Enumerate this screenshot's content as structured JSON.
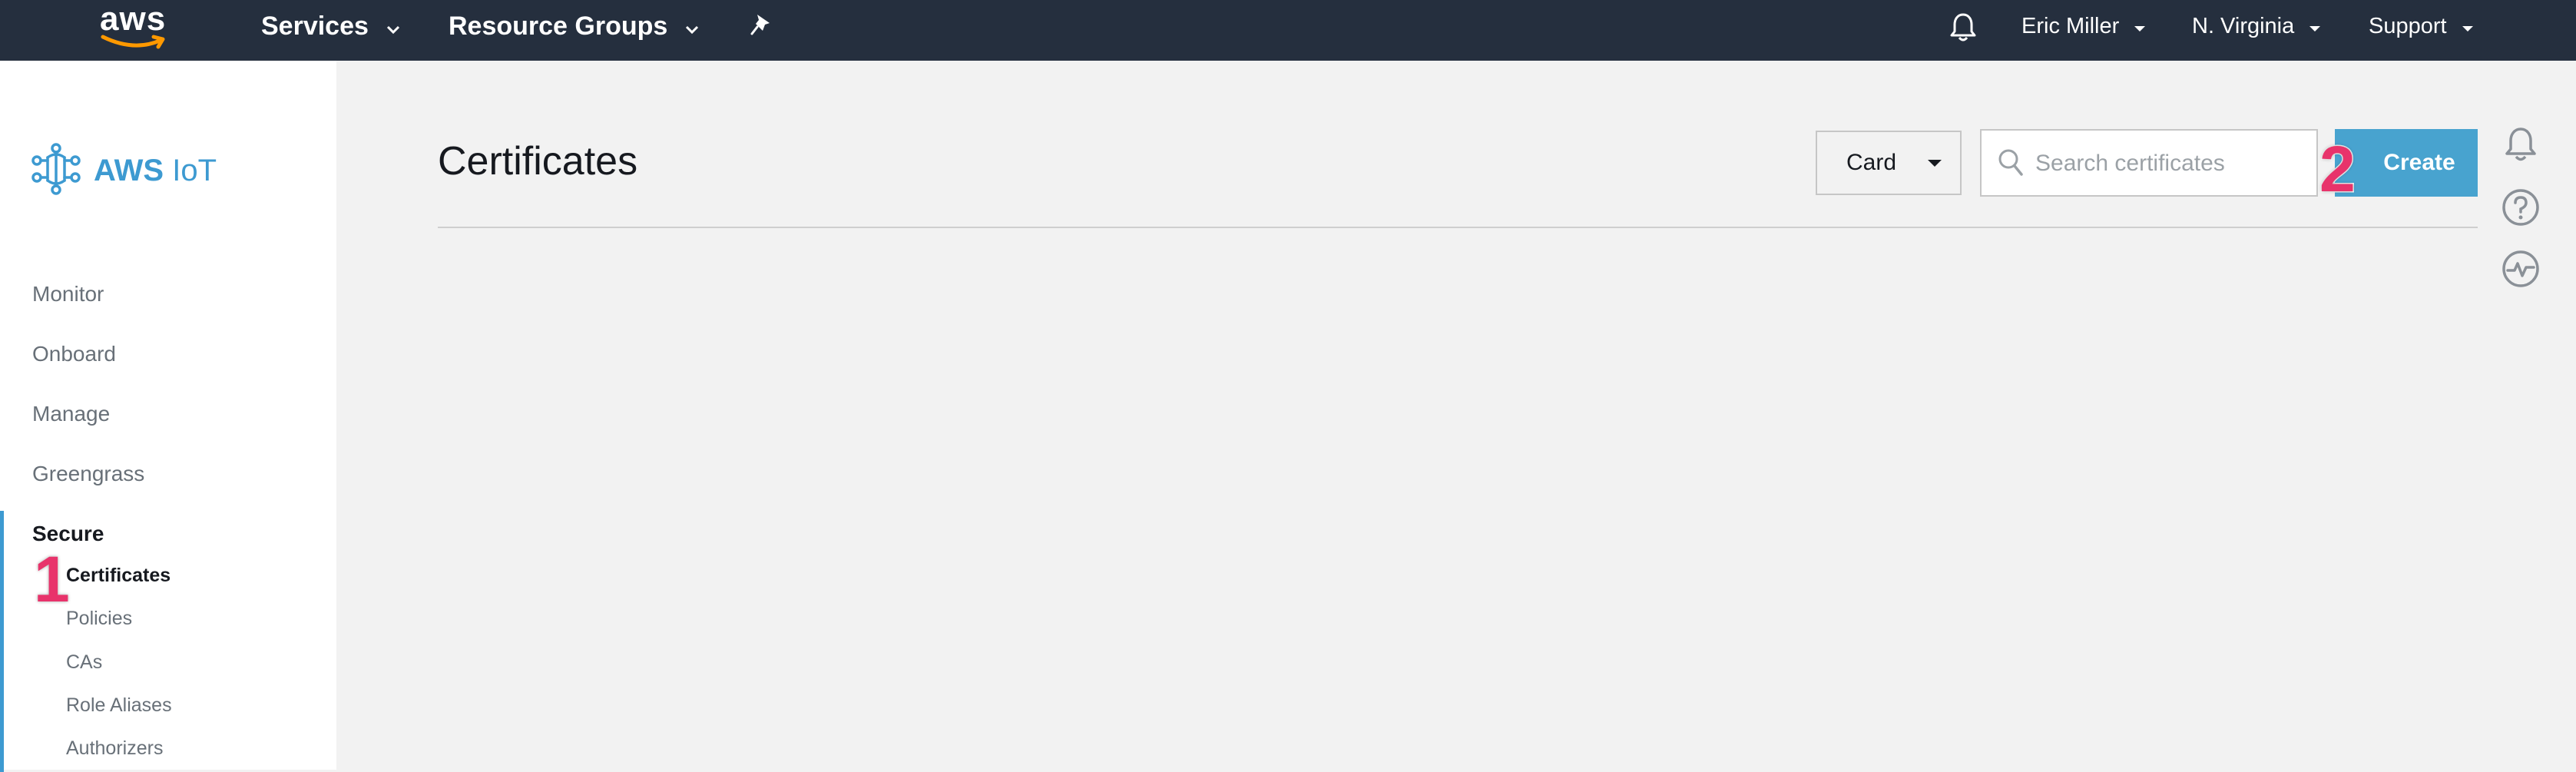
{
  "topbar": {
    "logo_text": "aws",
    "services_label": "Services",
    "resource_groups_label": "Resource Groups",
    "user_label": "Eric Miller",
    "region_label": "N. Virginia",
    "support_label": "Support"
  },
  "sidebar": {
    "brand_bold": "AWS",
    "brand_light": "IoT",
    "items": [
      {
        "label": "Monitor"
      },
      {
        "label": "Onboard"
      },
      {
        "label": "Manage"
      },
      {
        "label": "Greengrass"
      },
      {
        "label": "Secure"
      }
    ],
    "secure_children": [
      {
        "label": "Certificates"
      },
      {
        "label": "Policies"
      },
      {
        "label": "CAs"
      },
      {
        "label": "Role Aliases"
      },
      {
        "label": "Authorizers"
      }
    ]
  },
  "main": {
    "title": "Certificates",
    "view_select_value": "Card",
    "search_placeholder": "Search certificates",
    "search_value": "",
    "create_label": "Create"
  },
  "badges": {
    "step1": "1",
    "step2": "2",
    "color": "#e8336b"
  },
  "colors": {
    "topbar_bg": "#252f3e",
    "accent": "#3d9ad1",
    "create_button": "#48a3cf",
    "content_bg": "#f2f2f2"
  },
  "icons": [
    "aws-logo",
    "chevron-down-icon",
    "pin-icon",
    "bell-icon",
    "aws-iot-logo-icon",
    "search-icon",
    "caret-down-icon",
    "help-icon",
    "activity-icon"
  ]
}
